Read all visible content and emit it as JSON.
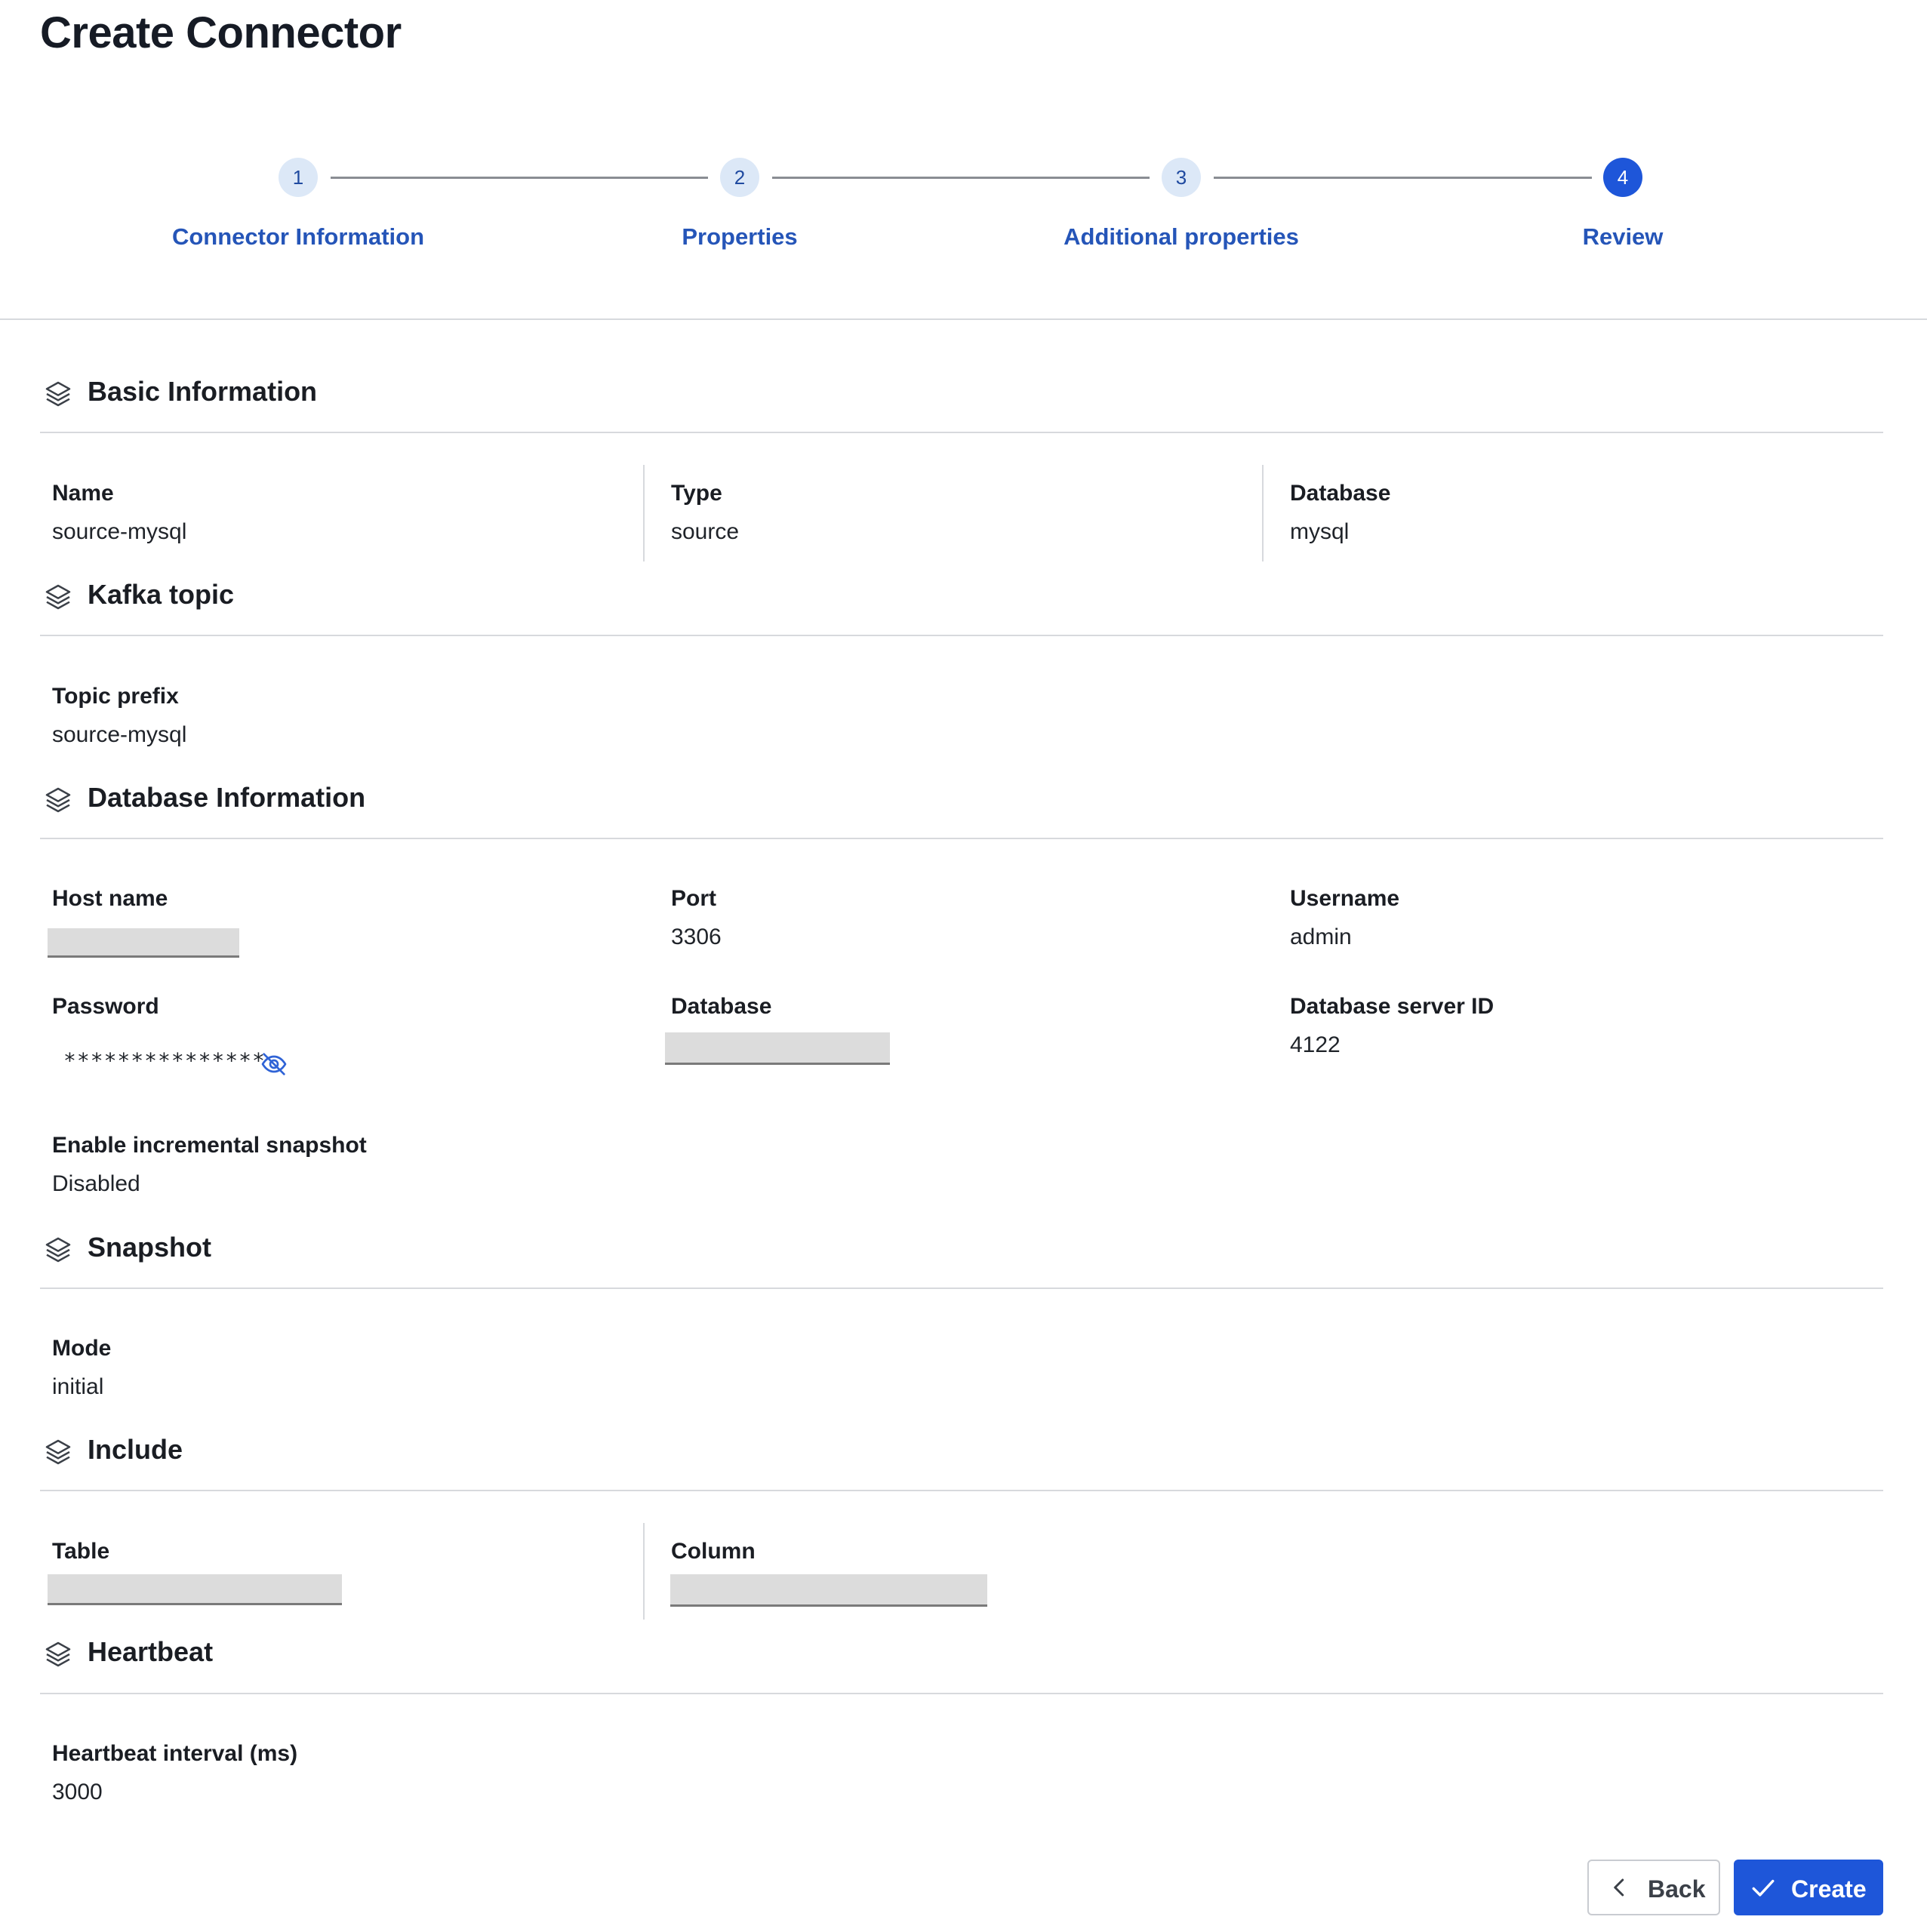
{
  "page": {
    "title": "Create Connector"
  },
  "stepper": {
    "steps": [
      {
        "number": "1",
        "label": "Connector Information",
        "state": "inactive"
      },
      {
        "number": "2",
        "label": "Properties",
        "state": "inactive"
      },
      {
        "number": "3",
        "label": "Additional properties",
        "state": "inactive"
      },
      {
        "number": "4",
        "label": "Review",
        "state": "active"
      }
    ]
  },
  "sections": {
    "basic": {
      "title": "Basic Information",
      "name_label": "Name",
      "name_value": "source-mysql",
      "type_label": "Type",
      "type_value": "source",
      "database_label": "Database",
      "database_value": "mysql"
    },
    "kafka": {
      "title": "Kafka topic",
      "topic_prefix_label": "Topic prefix",
      "topic_prefix_value": "source-mysql"
    },
    "database": {
      "title": "Database Information",
      "host_label": "Host name",
      "port_label": "Port",
      "port_value": "3306",
      "username_label": "Username",
      "username_value": "admin",
      "password_label": "Password",
      "password_value": "***************",
      "database_label": "Database",
      "server_id_label": "Database server ID",
      "server_id_value": "4122",
      "incremental_label": "Enable incremental snapshot",
      "incremental_value": "Disabled"
    },
    "snapshot": {
      "title": "Snapshot",
      "mode_label": "Mode",
      "mode_value": "initial"
    },
    "include": {
      "title": "Include",
      "table_label": "Table",
      "column_label": "Column"
    },
    "heartbeat": {
      "title": "Heartbeat",
      "interval_label": "Heartbeat interval (ms)",
      "interval_value": "3000"
    }
  },
  "icons": {
    "section": "layers-icon",
    "password_toggle": "eye-slash-icon",
    "back": "chevron-left-icon",
    "create": "check-icon"
  },
  "footer": {
    "back_label": "Back",
    "create_label": "Create"
  },
  "colors": {
    "primary": "#1e56d9",
    "step_inactive_bg": "#dce8f7",
    "step_label": "#2555b8",
    "divider": "#d7d9dd"
  }
}
